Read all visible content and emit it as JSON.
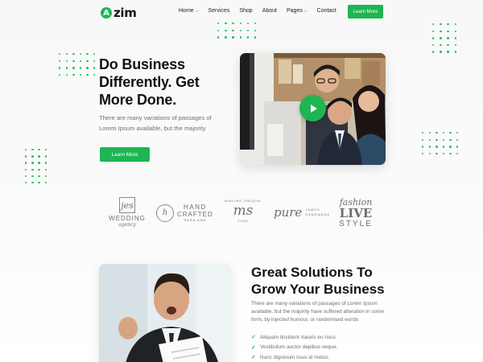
{
  "brand": {
    "logo_letter": "A",
    "name": "zim",
    "accent_color": "#1fb552"
  },
  "nav": {
    "items": [
      {
        "label": "Home",
        "has_dropdown": true
      },
      {
        "label": "Services",
        "has_dropdown": false
      },
      {
        "label": "Shop",
        "has_dropdown": false
      },
      {
        "label": "About",
        "has_dropdown": false
      },
      {
        "label": "Pages",
        "has_dropdown": true
      },
      {
        "label": "Contact",
        "has_dropdown": false
      }
    ],
    "cta_label": "Learn More"
  },
  "hero": {
    "title": "Do Business Differently. Get More Done.",
    "description": "There are many variations of passages of Lorem Ipsum available, but the majority",
    "button_label": "Learn More",
    "video_icon": "play-icon"
  },
  "brands": [
    {
      "name": "jes",
      "line1": "WEDDING",
      "line2": "agency"
    },
    {
      "name": "h",
      "line1": "HAND",
      "line2": "CRAFTED",
      "line3": "SARA ANN"
    },
    {
      "name": "ms",
      "line1": "MAKING",
      "line2": "UNIQUE",
      "line3": "FIND"
    },
    {
      "name": "pure",
      "line1": "JAMES",
      "line2": "HANDMADE"
    },
    {
      "name": "fashion",
      "line1": "LIVE",
      "line2": "STYLE"
    }
  ],
  "section": {
    "title": "Great Solutions To Grow Your Business",
    "description": "There are many variations of passages of Lorem Ipsum available, but the majority have suffered alteration in some form, by injected humour, or randomised words",
    "checklist": [
      "Aliquam tincidunt mauris eu risus.",
      "Vestibulum auctor dapibus neque.",
      "Nunc dignissim risus id metus."
    ]
  }
}
